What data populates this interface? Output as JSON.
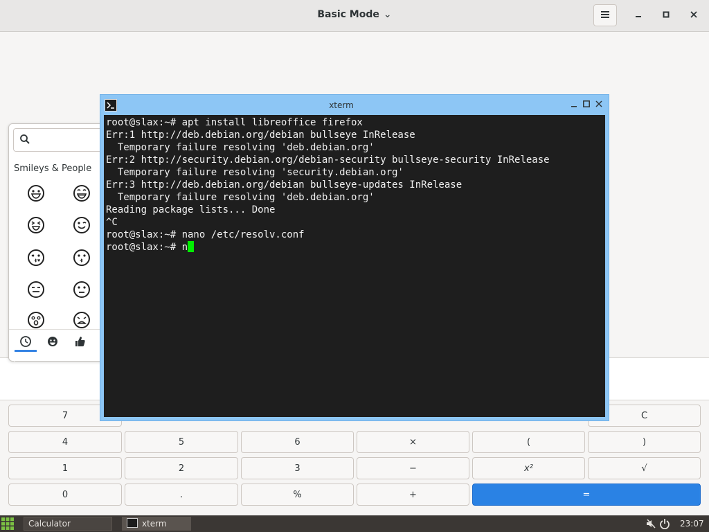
{
  "calculator": {
    "title": "Basic Mode",
    "keys": {
      "row0": {
        "seven": "7",
        "clear": "C"
      },
      "row1": {
        "four": "4",
        "five": "5",
        "six": "6",
        "times": "×",
        "lparen": "(",
        "rparen": ")"
      },
      "row2": {
        "one": "1",
        "two": "2",
        "three": "3",
        "minus": "−",
        "square": "x²",
        "sqrt": "√"
      },
      "row3": {
        "zero": "0",
        "dot": ".",
        "percent": "%",
        "plus": "+",
        "equals": "="
      }
    },
    "accent_color": "#2a82e4"
  },
  "emoji_picker": {
    "search_placeholder": "",
    "category_label": "Smileys & People",
    "emojis": [
      "grinning-face",
      "grinning-squinting-face",
      "squinting-face",
      "winking-face",
      "kissing-heart-face",
      "kissing-face",
      "expressionless-face",
      "neutral-face",
      "hushed-face",
      "disappointed-face"
    ],
    "tabs": [
      "recent-clock-icon",
      "smileys-icon",
      "thumbs-up-icon"
    ],
    "active_tab": "recent-clock-icon"
  },
  "xterm": {
    "title": "xterm",
    "lines": [
      "root@slax:~# apt install libreoffice firefox",
      "Err:1 http://deb.debian.org/debian bullseye InRelease",
      "  Temporary failure resolving 'deb.debian.org'",
      "Err:2 http://security.debian.org/debian-security bullseye-security InRelease",
      "  Temporary failure resolving 'security.debian.org'",
      "Err:3 http://deb.debian.org/debian bullseye-updates InRelease",
      "  Temporary failure resolving 'deb.debian.org'",
      "Reading package lists... Done",
      "^C",
      "root@slax:~# nano /etc/resolv.conf"
    ],
    "current_prompt": "root@slax:~# n",
    "cursor_color": "#00ee00"
  },
  "taskbar": {
    "tasks": [
      {
        "label": "Calculator"
      },
      {
        "label": "xterm"
      }
    ],
    "clock": "23:07"
  }
}
